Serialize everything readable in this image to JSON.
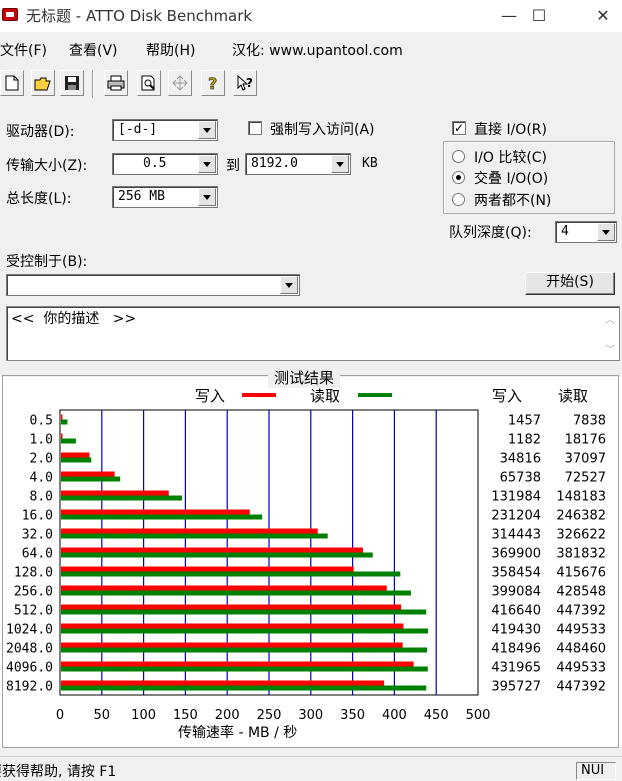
{
  "window": {
    "title": "无标题 - ATTO Disk Benchmark",
    "minimize": "—",
    "maximize": "☐",
    "close": "✕"
  },
  "menu": {
    "file": "文件(F)",
    "view": "查看(V)",
    "help": "帮助(H)",
    "localized": "汉化: www.upantool.com"
  },
  "toolbar": {
    "icons": [
      "new-icon",
      "open-icon",
      "save-icon",
      "print-icon",
      "print-preview-icon",
      "move-icon",
      "help-icon",
      "context-help-icon"
    ]
  },
  "settings": {
    "drive_label": "驱动器(D):",
    "drive_value": "[-d-]",
    "force_write_label": "强制写入访问(A)",
    "force_write_checked": false,
    "transfer_label": "传输大小(Z):",
    "transfer_from": "0.5",
    "to_label": "到",
    "transfer_to": "8192.0",
    "kb_label": "KB",
    "total_label": "总长度(L):",
    "total_value": "256 MB",
    "direct_io_label": "直接 I/O(R)",
    "direct_io_checked": true,
    "io_compare_label": "I/O 比较(C)",
    "overlap_io_label": "交叠 I/O(O)",
    "neither_label": "两者都不(N)",
    "selected_mode": "overlap",
    "queue_label": "队列深度(Q):",
    "queue_value": "4",
    "controlled_by_label": "受控制于(B):",
    "controlled_by_value": "",
    "start_button": "开始(S)",
    "description": "<<  你的描述   >>"
  },
  "results": {
    "group_title": "测试结果",
    "legend_write": "写入",
    "legend_read": "读取",
    "col_write": "写入",
    "col_read": "读取",
    "x_axis_label": "传输速率 - MB / 秒",
    "write_color": "#ff0000",
    "read_color": "#008000",
    "grid_color": "#0000cc"
  },
  "chart_data": {
    "type": "bar",
    "orientation": "horizontal",
    "categories": [
      "0.5",
      "1.0",
      "2.0",
      "4.0",
      "8.0",
      "16.0",
      "32.0",
      "64.0",
      "128.0",
      "256.0",
      "512.0",
      "1024.0",
      "2048.0",
      "4096.0",
      "8192.0"
    ],
    "series": [
      {
        "name": "写入",
        "color": "#ff0000",
        "values": [
          1.4,
          1.2,
          34.0,
          64.2,
          128.9,
          225.8,
          307.1,
          361.2,
          350.1,
          389.7,
          406.9,
          409.6,
          408.7,
          421.8,
          386.5
        ]
      },
      {
        "name": "读取",
        "color": "#008000",
        "values": [
          7.7,
          17.8,
          36.2,
          70.8,
          144.7,
          240.6,
          319.0,
          372.9,
          405.9,
          418.6,
          436.9,
          439.0,
          437.9,
          438.8,
          436.9
        ]
      }
    ],
    "write_kb": [
      "1457",
      "1182",
      "34816",
      "65738",
      "131984",
      "231204",
      "314443",
      "369900",
      "358454",
      "399084",
      "416640",
      "419430",
      "418496",
      "431965",
      "395727"
    ],
    "read_kb": [
      "7838",
      "18176",
      "37097",
      "72527",
      "148183",
      "246382",
      "326622",
      "381832",
      "415676",
      "428548",
      "447392",
      "449533",
      "448460",
      "449533",
      "447392"
    ],
    "x_ticks": [
      "0",
      "50",
      "100",
      "150",
      "200",
      "250",
      "300",
      "350",
      "400",
      "450",
      "500"
    ],
    "xlim": [
      0,
      500
    ],
    "xlabel": "传输速率 - MB / 秒",
    "grid": true,
    "legend": "top"
  },
  "statusbar": {
    "help_text": "要获得帮助, 请按 F1",
    "num": "NUI"
  }
}
